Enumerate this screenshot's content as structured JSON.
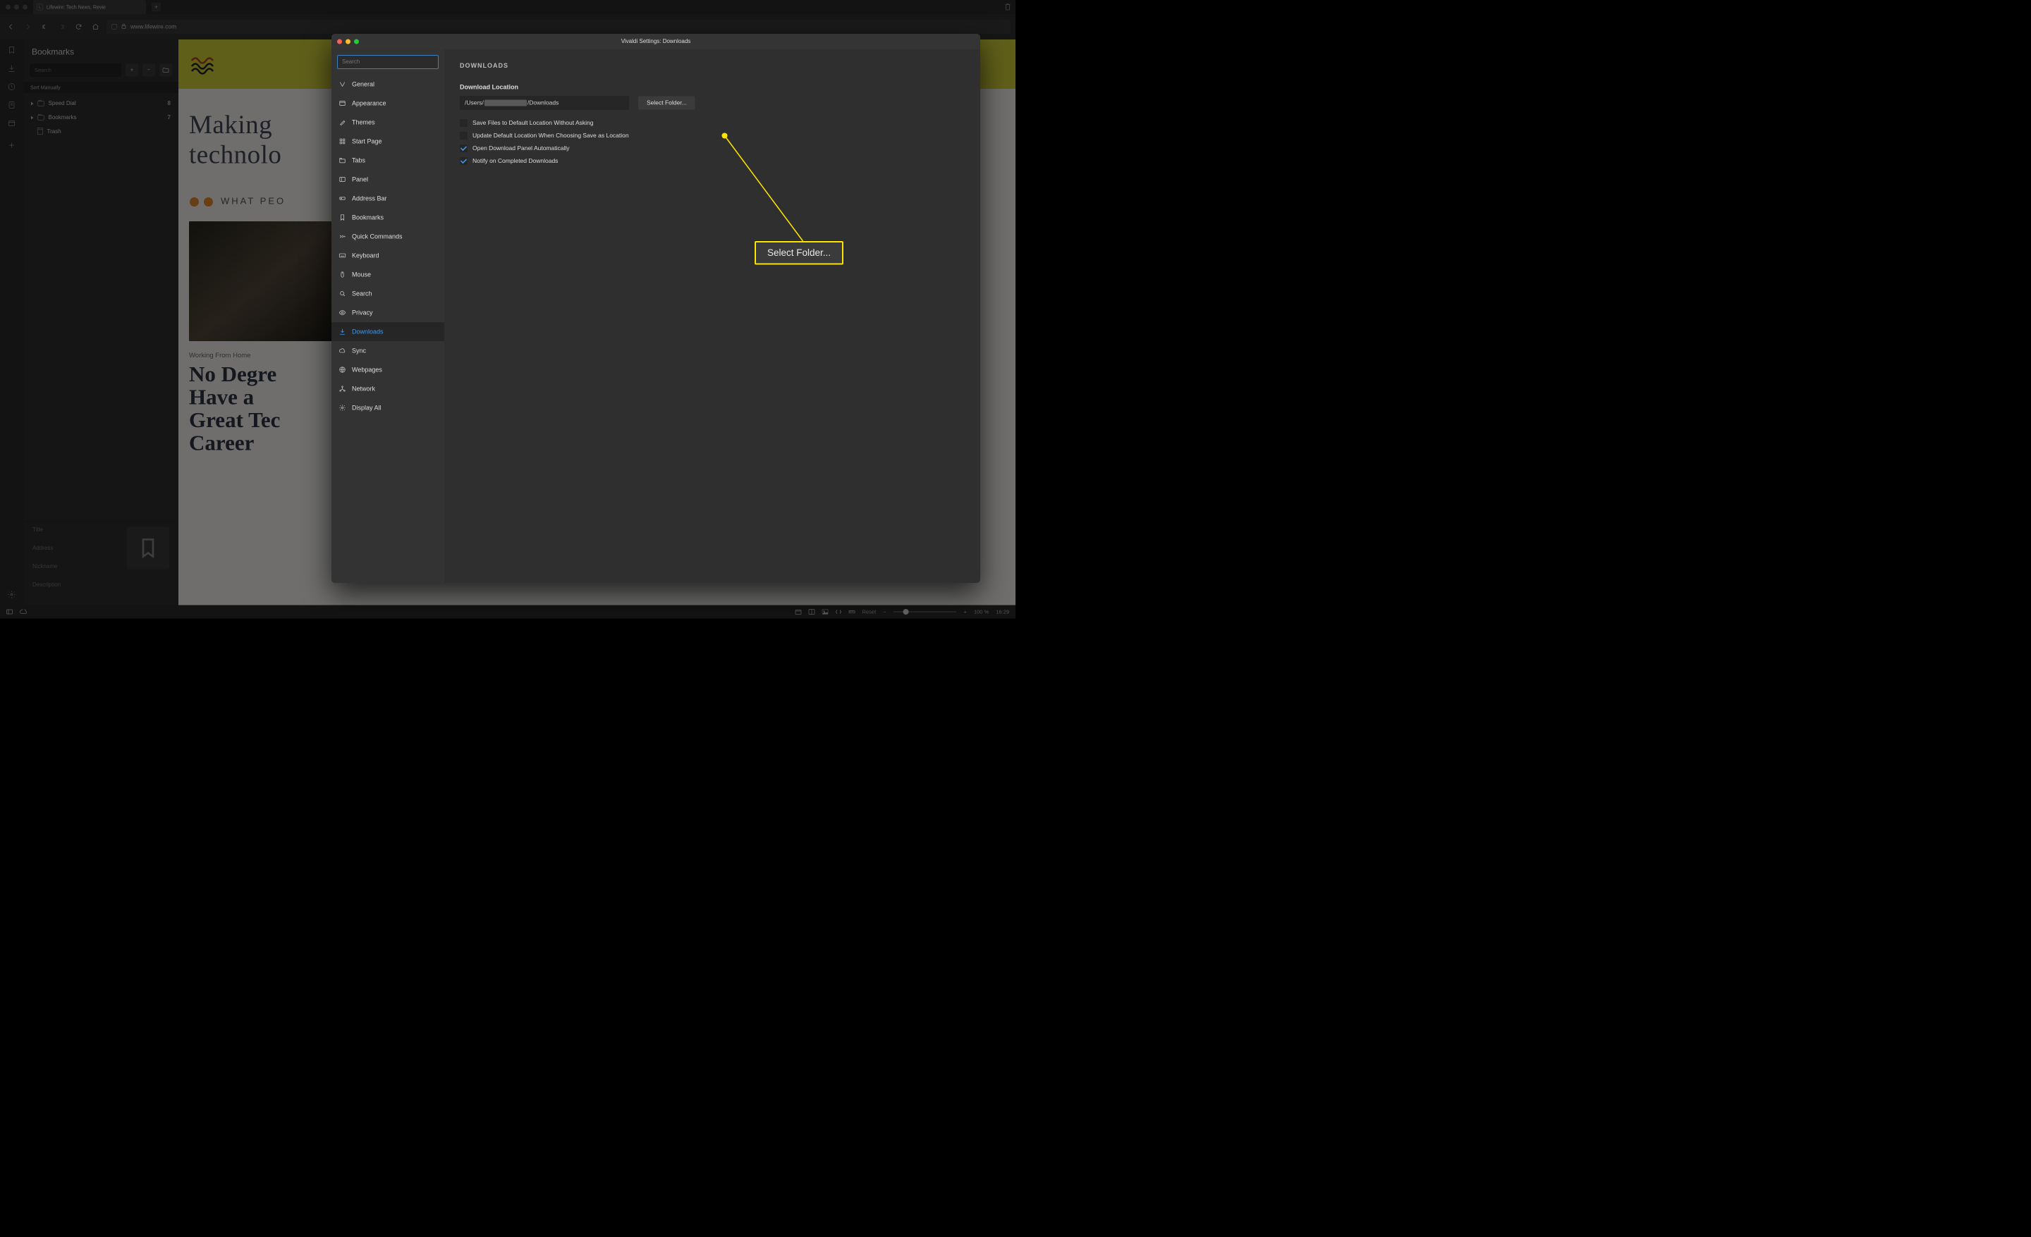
{
  "tab": {
    "title": "Lifewire: Tech News, Revie"
  },
  "toolbar": {
    "url": "www.lifewire.com"
  },
  "bookmarks_panel": {
    "title": "Bookmarks",
    "search_placeholder": "Search",
    "sort_label": "Sort Manually",
    "items": [
      {
        "label": "Speed Dial",
        "count": "8"
      },
      {
        "label": "Bookmarks",
        "count": "7"
      },
      {
        "label": "Trash",
        "count": ""
      }
    ],
    "detail_labels": {
      "title": "Title",
      "address": "Address",
      "nickname": "Nickname",
      "description": "Description"
    }
  },
  "page": {
    "headline1": "Making",
    "headline2": "technolo",
    "subhead": "WHAT PEO",
    "kicker": "Working From Home",
    "article_title_lines": [
      "No Degre",
      "Have a",
      "Great Tec",
      "Career"
    ]
  },
  "settings": {
    "window_title": "Vivaldi Settings: Downloads",
    "search_placeholder": "Search",
    "sidebar": [
      {
        "label": "General",
        "icon": "v"
      },
      {
        "label": "Appearance",
        "icon": "window"
      },
      {
        "label": "Themes",
        "icon": "brush"
      },
      {
        "label": "Start Page",
        "icon": "grid"
      },
      {
        "label": "Tabs",
        "icon": "tabs"
      },
      {
        "label": "Panel",
        "icon": "panel"
      },
      {
        "label": "Address Bar",
        "icon": "addr"
      },
      {
        "label": "Bookmarks",
        "icon": "bookmark"
      },
      {
        "label": "Quick Commands",
        "icon": "chevrons"
      },
      {
        "label": "Keyboard",
        "icon": "keyboard"
      },
      {
        "label": "Mouse",
        "icon": "mouse"
      },
      {
        "label": "Search",
        "icon": "search"
      },
      {
        "label": "Privacy",
        "icon": "eye"
      },
      {
        "label": "Downloads",
        "icon": "download",
        "active": true
      },
      {
        "label": "Sync",
        "icon": "cloud"
      },
      {
        "label": "Webpages",
        "icon": "globe"
      },
      {
        "label": "Network",
        "icon": "network"
      },
      {
        "label": "Display All",
        "icon": "gear"
      }
    ],
    "content": {
      "heading": "DOWNLOADS",
      "location_label": "Download Location",
      "path_prefix": "/Users/",
      "path_suffix": "/Downloads",
      "select_folder": "Select Folder...",
      "checks": [
        {
          "label": "Save Files to Default Location Without Asking",
          "checked": false
        },
        {
          "label": "Update Default Location When Choosing Save as Location",
          "checked": false
        },
        {
          "label": "Open Download Panel Automatically",
          "checked": true
        },
        {
          "label": "Notify on Completed Downloads",
          "checked": true
        }
      ]
    }
  },
  "callout": {
    "label": "Select Folder..."
  },
  "statusbar": {
    "reset": "Reset",
    "zoom": "100 %",
    "time": "16:29"
  }
}
